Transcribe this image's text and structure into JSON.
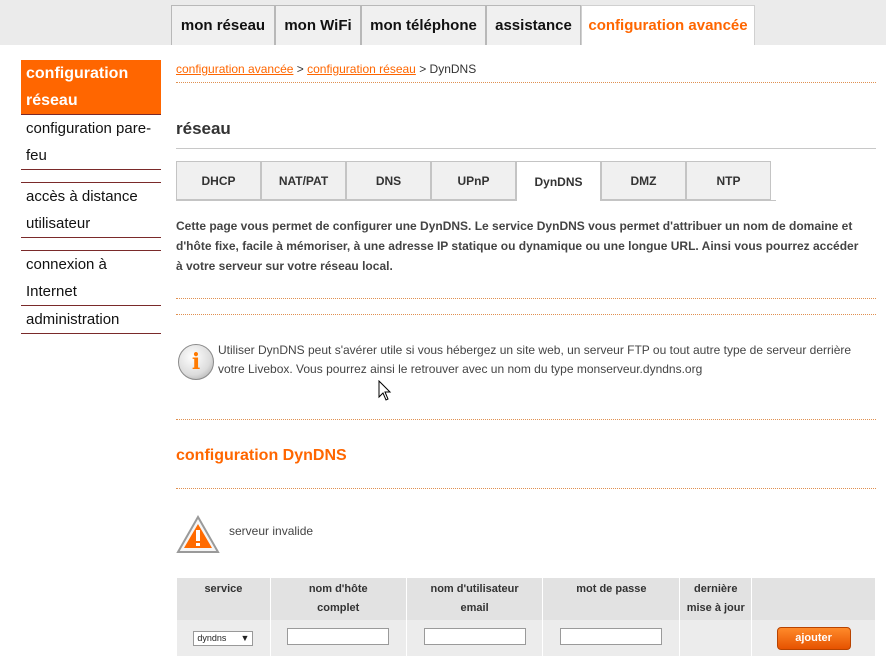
{
  "top_nav": {
    "tabs": [
      {
        "label": "mon réseau"
      },
      {
        "label": "mon WiFi"
      },
      {
        "label": "mon téléphone"
      },
      {
        "label": "assistance"
      },
      {
        "label": "configuration avancée",
        "active": true
      }
    ]
  },
  "sidebar": {
    "items": [
      {
        "label": "configuration réseau",
        "active": true
      },
      {
        "label": "configuration pare-feu"
      },
      {
        "label": "accès à distance utilisateur"
      },
      {
        "label": "connexion à Internet"
      },
      {
        "label": "administration"
      }
    ]
  },
  "breadcrumb": {
    "link1": "configuration avancée",
    "sep1": " > ",
    "link2": "configuration réseau",
    "sep2": " > ",
    "current": "DynDNS"
  },
  "section_title": "réseau",
  "subtabs": [
    {
      "label": "DHCP"
    },
    {
      "label": "NAT/PAT"
    },
    {
      "label": "DNS"
    },
    {
      "label": "UPnP"
    },
    {
      "label": "DynDNS",
      "active": true
    },
    {
      "label": "DMZ"
    },
    {
      "label": "NTP"
    }
  ],
  "description": "Cette page vous permet de configurer une DynDNS. Le service DynDNS vous permet d'attribuer un nom de domaine et d'hôte fixe, facile à mémoriser, à une adresse IP statique ou dynamique ou une longue URL. Ainsi vous pourrez accéder à votre serveur sur votre réseau local.",
  "info": {
    "icon": "info-icon",
    "text": "Utiliser DynDNS peut s'avérer utile si vous hébergez un site web, un serveur FTP ou tout autre type de serveur derrière votre Livebox. Vous pourrez ainsi le retrouver avec un nom du type monserveur.dyndns.org"
  },
  "config_title": "configuration DynDNS",
  "warning": {
    "icon": "warning-icon",
    "text": "serveur invalide"
  },
  "table": {
    "headers": {
      "service": "service",
      "hostname_1": "nom d'hôte",
      "hostname_2": "complet",
      "username_1": "nom d'utilisateur",
      "username_2": "email",
      "password": "mot de passe",
      "last_1": "dernière",
      "last_2": "mise à jour"
    },
    "row": {
      "service_value": "dyndns",
      "hostname_value": "",
      "username_value": "",
      "password_value": "",
      "add_label": "ajouter"
    }
  },
  "colors": {
    "accent": "#ff6600",
    "nav_bg": "#ebebeb"
  }
}
